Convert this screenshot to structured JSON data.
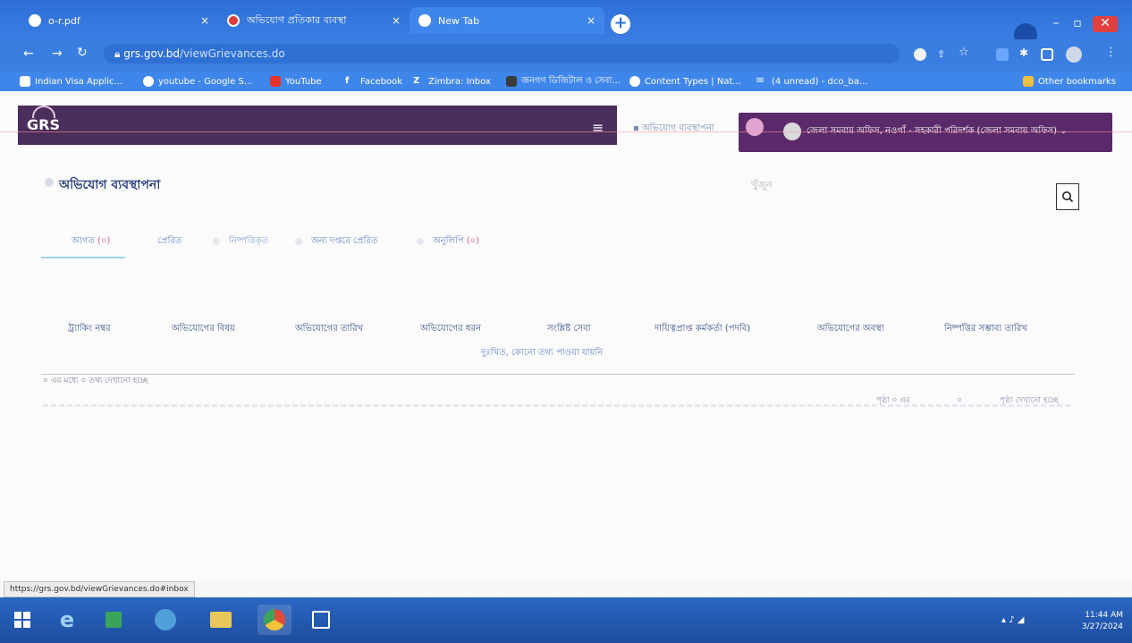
{
  "browser": {
    "tabs": [
      {
        "title": "o-r.pdf",
        "close": "×"
      },
      {
        "title": "অভিযোগ প্রতিকার ব্যবস্থা",
        "close": "×"
      },
      {
        "title": "New Tab",
        "close": "×"
      }
    ],
    "new_tab": "+",
    "url_host": "grs.gov.bd",
    "url_path": "/viewGrievances.do",
    "bookmarks": [
      "Indian Visa Applic...",
      "youtube - Google S...",
      "YouTube",
      "Facebook",
      "Zimbra: Inbox",
      "জনগণ ডিজিটাল ও সেবা...",
      "Content Types | Nat...",
      "(4 unread) - dco_ba...",
      "Other bookmarks"
    ],
    "status_url": "https://grs.gov.bd/viewGrievances.do#inbox",
    "accent": "#3a7ee2"
  },
  "app": {
    "logo": "GRS",
    "nav_link": "অভিযোগ ব্যবস্থাপনা",
    "user_name": "জেলা সমবায় অফিস, নওগাঁ - সহকারী পরিদর্শক (জেলা সমবায় অফিস)",
    "user_caret": "⌄",
    "header_color": "#4a2e5b"
  },
  "main": {
    "page_title": "অভিযোগ ব্যবস্থাপনা",
    "search_placeholder": "খুঁজুন",
    "tabs": [
      {
        "label": "আগত",
        "count": "(০)"
      },
      {
        "label": "প্রেরিত",
        "count": ""
      },
      {
        "label": "নিষ্পত্তিকৃত",
        "count": ""
      },
      {
        "label": "অন্য দপ্তরে প্রেরিত",
        "count": ""
      },
      {
        "label": "অনুলিপি",
        "count": "(০)"
      }
    ],
    "columns": [
      "ট্র্যাকিং নম্বর",
      "অভিযোগের বিষয়",
      "অভিযোগের তারিখ",
      "অভিযোগের ধরন",
      "সংশ্লিষ্ট সেবা",
      "দায়িত্বপ্রাপ্ত কর্মকর্তা (পদবি)",
      "অভিযোগের অবস্থা",
      "নিষ্পত্তির সম্ভাব্য তারিখ"
    ],
    "empty_message": "দুঃখিত, কোনো তথ্য পাওয়া যায়নি",
    "info": "০ এর মধ্যে ০ তথ্য দেখানো হচ্ছে",
    "pager_left": "পৃষ্ঠা ০ এর",
    "pager_mid": "০",
    "pager_right": "পৃষ্ঠা দেখানো হচ্ছে"
  },
  "taskbar": {
    "time": "11:44 AM",
    "date": "3/27/2024"
  }
}
